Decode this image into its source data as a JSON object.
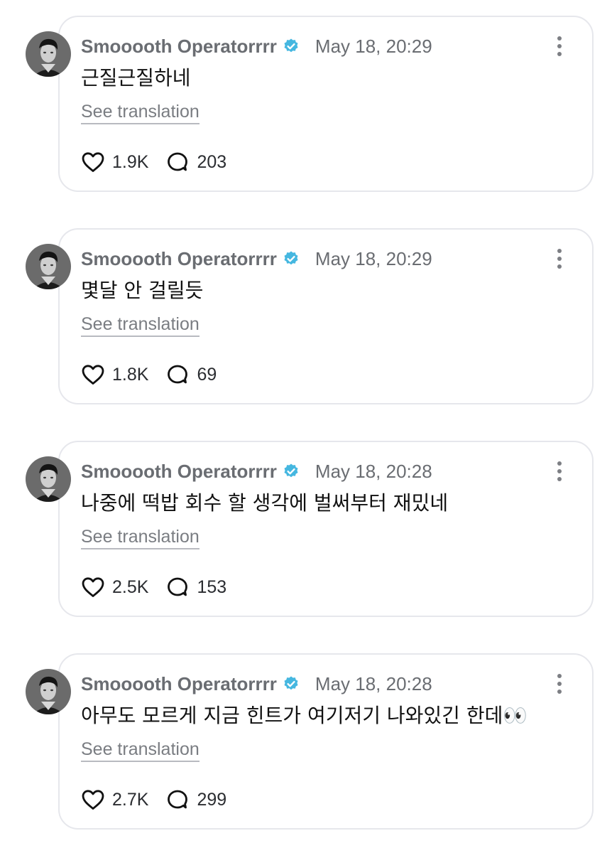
{
  "colors": {
    "author": "#6a6d72",
    "verified": "#45b7e0",
    "text": "#111111",
    "border": "#e6e7ec",
    "muted": "#7a7d82"
  },
  "posts": [
    {
      "author": "Smooooth Operatorrrr",
      "timestamp": "May 18, 20:29",
      "text": "근질근질하네",
      "translate_label": "See translation",
      "likes": "1.9K",
      "comments": "203"
    },
    {
      "author": "Smooooth Operatorrrr",
      "timestamp": "May 18, 20:29",
      "text": "몇달 안 걸릴듯",
      "translate_label": "See translation",
      "likes": "1.8K",
      "comments": "69"
    },
    {
      "author": "Smooooth Operatorrrr",
      "timestamp": "May 18, 20:28",
      "text": "나중에 떡밥 회수 할 생각에 벌써부터 재밌네",
      "translate_label": "See translation",
      "likes": "2.5K",
      "comments": "153"
    },
    {
      "author": "Smooooth Operatorrrr",
      "timestamp": "May 18, 20:28",
      "text": "아무도 모르게 지금 힌트가 여기저기 나와있긴 한데👀",
      "translate_label": "See translation",
      "likes": "2.7K",
      "comments": "299"
    }
  ],
  "icons": {
    "verified": "verified-badge-icon",
    "more": "more-vertical-icon",
    "like": "heart-icon",
    "comment": "comment-bubble-icon"
  }
}
